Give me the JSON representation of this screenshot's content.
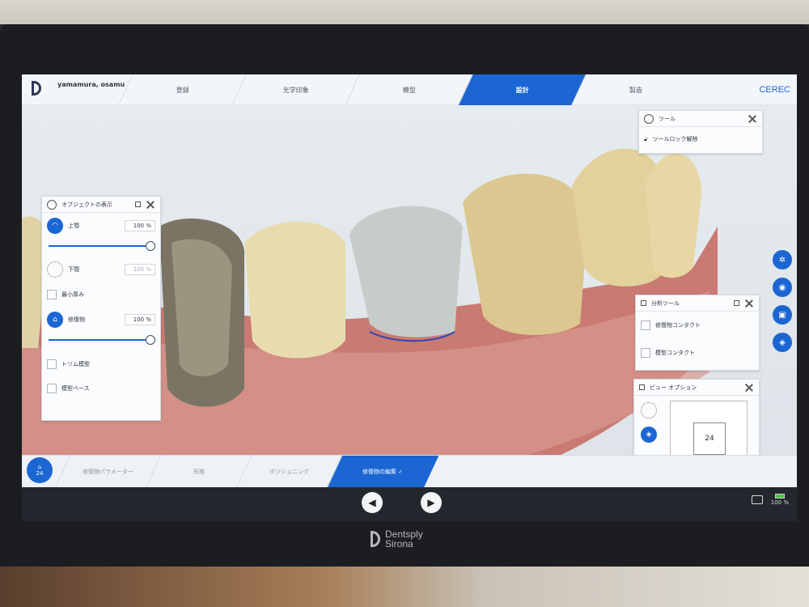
{
  "header": {
    "user": "yamamura, osamu",
    "tabs": [
      {
        "label": "登録",
        "active": false
      },
      {
        "label": "光学印象",
        "active": false
      },
      {
        "label": "模型",
        "active": false
      },
      {
        "label": "設計",
        "active": true
      },
      {
        "label": "製造",
        "active": false
      }
    ],
    "brand": "CEREC"
  },
  "object_panel": {
    "title": "オブジェクトの表示",
    "rows": [
      {
        "label": "上顎",
        "value": "100 %"
      },
      {
        "label": "下顎",
        "value": "100 %"
      },
      {
        "label": "最小厚み"
      },
      {
        "label": "修復物",
        "value": "100 %"
      },
      {
        "label": "トリム模型"
      },
      {
        "label": "模型ベース"
      }
    ],
    "sliders": [
      1.0,
      1.0
    ]
  },
  "tool_panel": {
    "title": "ツール",
    "item": "ツールロック解除"
  },
  "analysis_panel": {
    "title": "分析ツール",
    "items": [
      "修復物コンタクト",
      "模型コンタクト"
    ]
  },
  "view_panel": {
    "title": "ビュー オプション",
    "cube_label": "24"
  },
  "stepbar": {
    "tooth": "24",
    "steps": [
      {
        "label": "修復物パラメーター",
        "active": false
      },
      {
        "label": "形態",
        "active": false
      },
      {
        "label": "ポジショニング",
        "active": false
      },
      {
        "label": "修復物の編集",
        "active": true
      }
    ],
    "check": "✓"
  },
  "status": {
    "battery": "100 %"
  },
  "bezel_brand": [
    "Dentsply",
    "Sirona"
  ],
  "colors": {
    "accent": "#1b66d2"
  }
}
